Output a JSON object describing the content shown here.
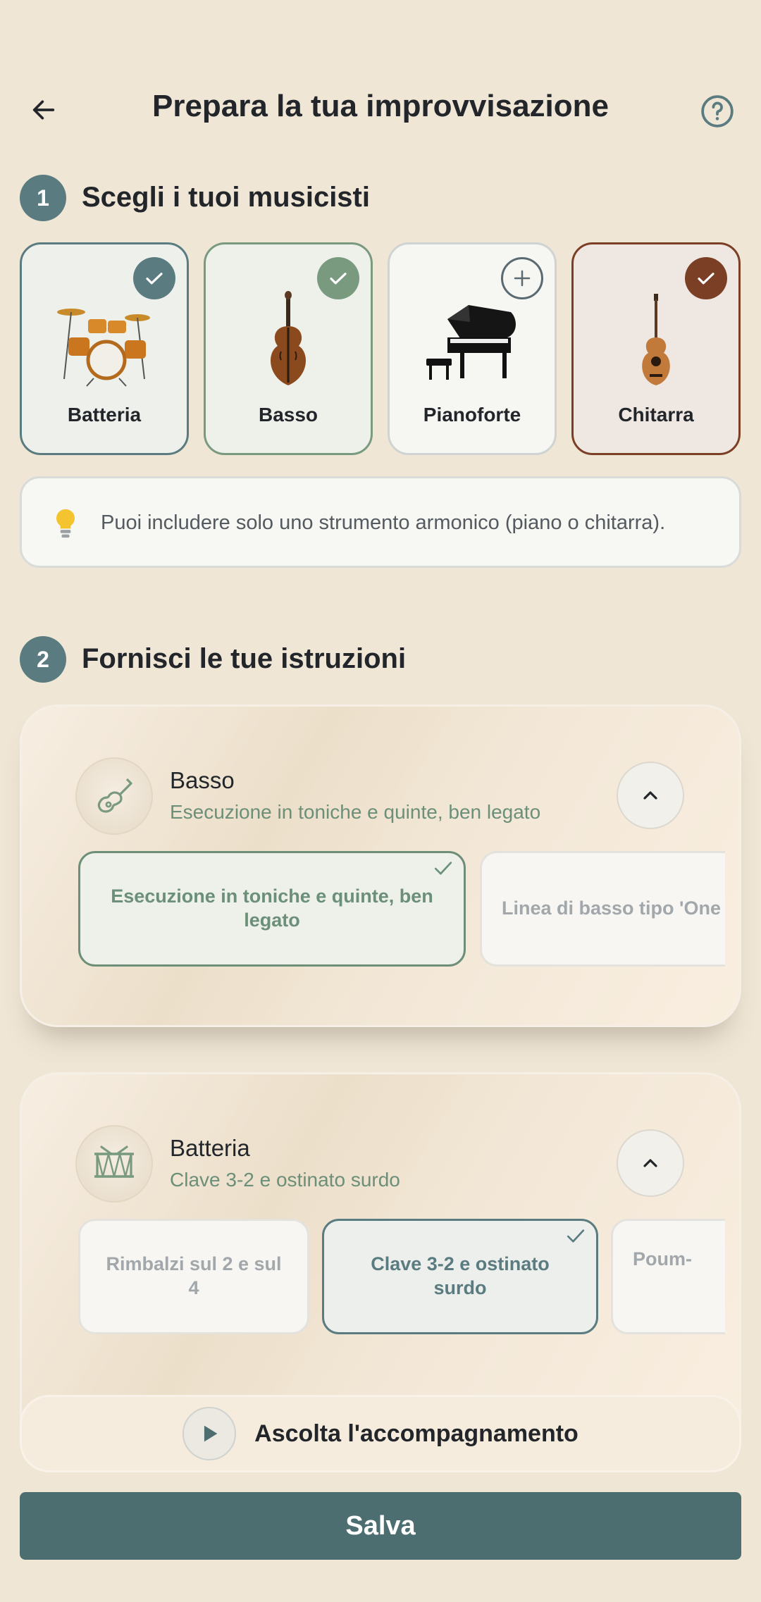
{
  "header": {
    "title": "Prepara la tua improvvisazione",
    "back_icon": "arrow-left-icon",
    "help_icon": "help-circle-icon"
  },
  "section1": {
    "step": "1",
    "title": "Scegli i tuoi musicisti",
    "instruments": [
      {
        "label": "Batteria",
        "selected": true,
        "icon": "drum-kit-icon",
        "accent": "#5a7c80"
      },
      {
        "label": "Basso",
        "selected": true,
        "icon": "double-bass-icon",
        "accent": "#7a9a80"
      },
      {
        "label": "Pianoforte",
        "selected": false,
        "icon": "grand-piano-icon",
        "accent": "#5a6a70"
      },
      {
        "label": "Chitarra",
        "selected": true,
        "icon": "guitar-icon",
        "accent": "#7a3f25"
      }
    ],
    "info": "Puoi includere solo uno strumento armonico (piano o chitarra)."
  },
  "section2": {
    "step": "2",
    "title": "Fornisci le tue istruzioni",
    "panels": [
      {
        "name": "Basso",
        "selected": "Esecuzione in toniche e quinte, ben legato",
        "options": [
          "Esecuzione in toniche e quinte, ben legato",
          "Linea di basso tipo 'One"
        ]
      },
      {
        "name": "Batteria",
        "selected": "Clave 3-2 e ostinato surdo",
        "options": [
          "Rimbalzi sul 2 e sul 4",
          "Clave 3-2 e ostinato surdo",
          "Poum-"
        ]
      }
    ]
  },
  "actions": {
    "listen": "Ascolta l'accompagnamento",
    "save": "Salva"
  },
  "colors": {
    "background": "#f0e6d6",
    "primary": "#4d6e70",
    "green": "#6b8f78",
    "brown": "#7a3f25"
  }
}
